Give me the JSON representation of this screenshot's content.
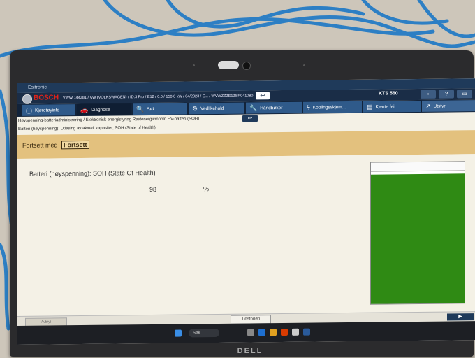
{
  "app": {
    "window_title": "Esitronic",
    "brand": "BOSCH",
    "vehicle": "VWW 144381 / VW (VOLKSWAGEN) / ID.3 Pro / E12 / 0.0 / 150.0 kW / 04/2023 / E... / WVWZZZE1ZSP041080",
    "device": "KTS 560",
    "help": "?",
    "back_glyph": "↩"
  },
  "nav": {
    "items": [
      {
        "label": "Kjøretøyinfo",
        "icon": "info-icon",
        "glyph": "ⓘ"
      },
      {
        "label": "Diagnose",
        "icon": "car-icon",
        "glyph": "🚗"
      },
      {
        "label": "Søk",
        "icon": "search-icon",
        "glyph": "🔍"
      },
      {
        "label": "Vedlikehold",
        "icon": "gears-icon",
        "glyph": "⚙"
      },
      {
        "label": "Håndbøker",
        "icon": "wrench-icon",
        "glyph": "🔧"
      },
      {
        "label": "Koblingsskjem...",
        "icon": "lightning-icon",
        "glyph": "ϟ"
      },
      {
        "label": "Kjente feil",
        "icon": "book-icon",
        "glyph": "▤"
      },
      {
        "label": "Utstyr",
        "icon": "external-icon",
        "glyph": "↗"
      }
    ]
  },
  "breadcrumb": "Høyspenning-batteriadministrering / Elektronisk energistyring Restenergiinnhold HV-batteri (SOH)",
  "subtitle": "Batteri (høyspenning): Utlesing av aktuell kapasitet, SOH (State of Health)",
  "continue": {
    "text": "Fortsett med",
    "button": "Fortsett"
  },
  "measurement": {
    "label": "Batteri (høyspenning): SOH (State Of Health)",
    "value": "98",
    "unit": "%",
    "gauge_fraction": 0.98,
    "gauge_color": "#2f8a14"
  },
  "bottom": {
    "left_button": "Avbryt",
    "center_button": "Tidsforløp",
    "next_button": "▶"
  },
  "taskbar": {
    "search": "Søk"
  },
  "laptop_brand": "DELL"
}
